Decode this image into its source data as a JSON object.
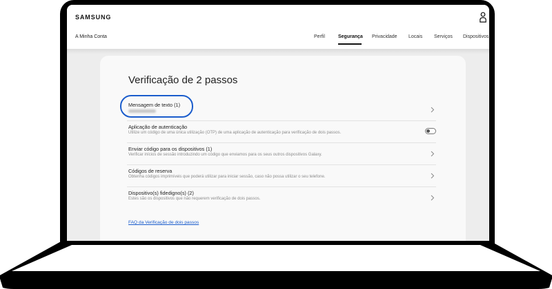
{
  "header": {
    "logo": "SAMSUNG",
    "account_link": "A Minha Conta",
    "nav": [
      {
        "label": "Perfil"
      },
      {
        "label": "Segurança",
        "active": true
      },
      {
        "label": "Privacidade"
      },
      {
        "label": "Locais"
      },
      {
        "label": "Serviços"
      },
      {
        "label": "Dispositivos"
      }
    ],
    "user_icon": "user-icon"
  },
  "main": {
    "title": "Verificação de 2 passos",
    "options": [
      {
        "title": "Mensagem de texto (1)",
        "description": "",
        "control": "chevron-right-icon",
        "highlighted": true
      },
      {
        "title": "Aplicação de autenticação",
        "description": "Utilize um código de uma única utilização (OTP) de uma aplicação de autenticação para verificação de dois passos.",
        "control": "toggle",
        "toggle_on": false
      },
      {
        "title": "Enviar código para os dispositivos (1)",
        "description": "Verificar inícios de sessão introduzindo um código que enviamos para os seus outros dispositivos Galaxy.",
        "control": "chevron-right-icon"
      },
      {
        "title": "Códigos de reserva",
        "description": "Obtenha códigos imprimíveis que poderá utilizar para iniciar sessão, caso não possa utilizar o seu telefone.",
        "control": "chevron-right-icon"
      },
      {
        "title": "Dispositivo(s) fidedigno(s) (2)",
        "description": "Estes são os dispositivos que não requerem verificação de dois passos.",
        "control": "chevron-right-icon"
      }
    ],
    "faq_link": "FAQ da Verificação de dois passos"
  },
  "colors": {
    "accent": "#1a5ccc",
    "page_bg": "#ededed",
    "card_bg": "#f9f9f9",
    "device_frame": "#000000"
  }
}
